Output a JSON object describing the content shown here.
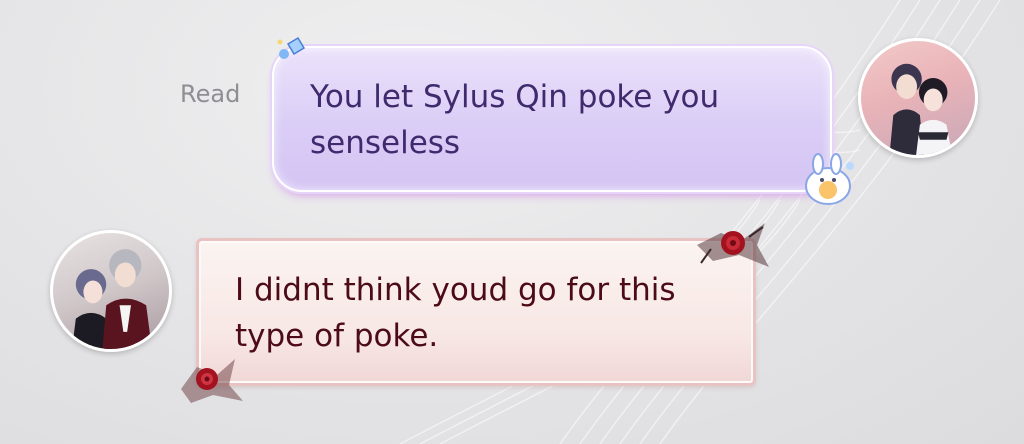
{
  "chat": {
    "read_receipt": "Read",
    "messages": [
      {
        "sender": "self",
        "text": "You let Sylus Qin poke you senseless"
      },
      {
        "sender": "other",
        "text": "I didnt think youd go for this type of poke."
      }
    ]
  },
  "icons": {
    "self_avatar": "avatar-couple-icon",
    "other_avatar": "avatar-couple-icon",
    "sent_bubble_decoration": "pastel-sticker-icon",
    "received_bubble_decoration": "red-rose-icon"
  },
  "colors": {
    "sent_bubble": "#dacdf6",
    "sent_text": "#3f2a6e",
    "received_bubble": "#f7e6e4",
    "received_border": "#e9c3c1",
    "received_text": "#4c0b16",
    "read_receipt": "#8e8e93"
  }
}
